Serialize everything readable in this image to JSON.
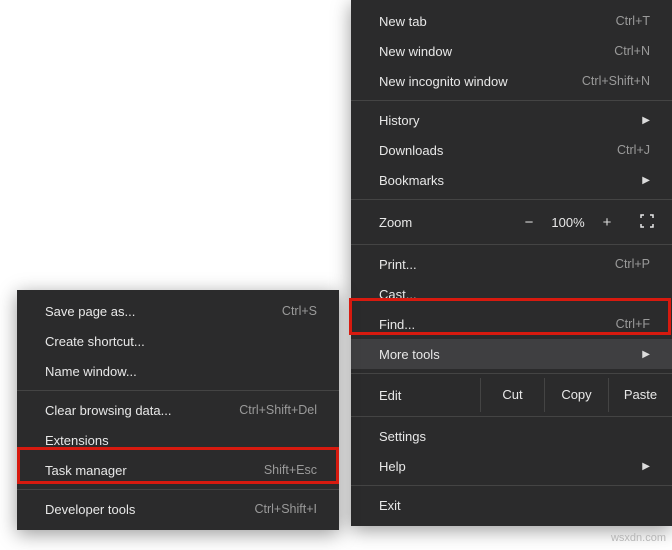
{
  "mainMenu": {
    "newTab": {
      "label": "New tab",
      "shortcut": "Ctrl+T"
    },
    "newWindow": {
      "label": "New window",
      "shortcut": "Ctrl+N"
    },
    "newIncognito": {
      "label": "New incognito window",
      "shortcut": "Ctrl+Shift+N"
    },
    "history": {
      "label": "History"
    },
    "downloads": {
      "label": "Downloads",
      "shortcut": "Ctrl+J"
    },
    "bookmarks": {
      "label": "Bookmarks"
    },
    "zoom": {
      "label": "Zoom",
      "minus": "−",
      "percent": "100%",
      "plus": "+"
    },
    "print": {
      "label": "Print...",
      "shortcut": "Ctrl+P"
    },
    "cast": {
      "label": "Cast..."
    },
    "find": {
      "label": "Find...",
      "shortcut": "Ctrl+F"
    },
    "moreTools": {
      "label": "More tools"
    },
    "edit": {
      "label": "Edit",
      "cut": "Cut",
      "copy": "Copy",
      "paste": "Paste"
    },
    "settings": {
      "label": "Settings"
    },
    "help": {
      "label": "Help"
    },
    "exit": {
      "label": "Exit"
    }
  },
  "subMenu": {
    "savePage": {
      "label": "Save page as...",
      "shortcut": "Ctrl+S"
    },
    "createShortcut": {
      "label": "Create shortcut..."
    },
    "nameWindow": {
      "label": "Name window..."
    },
    "clearBrowsing": {
      "label": "Clear browsing data...",
      "shortcut": "Ctrl+Shift+Del"
    },
    "extensions": {
      "label": "Extensions"
    },
    "taskManager": {
      "label": "Task manager",
      "shortcut": "Shift+Esc"
    },
    "devTools": {
      "label": "Developer tools",
      "shortcut": "Ctrl+Shift+I"
    }
  },
  "watermark": "wsxdn.com"
}
